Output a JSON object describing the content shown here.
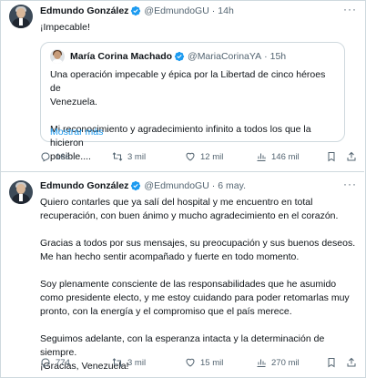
{
  "tweets": [
    {
      "author_name": "Edmundo González",
      "handle": "@EdmundoGU",
      "separator": "·",
      "time": "14h",
      "text": "¡Impecable!",
      "quote": {
        "author_name": "María Corina Machado",
        "handle": "@MariaCorinaYA",
        "separator": "·",
        "time": "15h",
        "text": "Una operación impecable y épica por la Libertad de cinco héroes de\nVenezuela.\n\nMi reconocimiento y agradecimiento infinito a todos los que la hicieron\nposible....",
        "show_more": "Mostrar más"
      },
      "replies": "166",
      "retweets": "3 mil",
      "likes": "12 mil",
      "views": "146 mil"
    },
    {
      "author_name": "Edmundo González",
      "handle": "@EdmundoGU",
      "separator": "·",
      "time": "6 may.",
      "text": "Quiero contarles que ya salí del hospital y me encuentro en total\nrecuperación, con buen ánimo y mucho agradecimiento en el corazón.\n\nGracias a todos por sus mensajes, su preocupación y sus buenos deseos.\nMe han hecho sentir acompañado y fuerte en todo momento.\n\nSoy plenamente consciente de las responsabilidades que he asumido\ncomo presidente electo, y me estoy cuidando para poder retomarlas muy\npronto, con la energía y el compromiso que el país merece.\n\nSeguimos adelante, con la esperanza intacta y la determinación de\nsiempre.\n¡Gracias, Venezuela!",
      "replies": "774",
      "retweets": "3 mil",
      "likes": "15 mil",
      "views": "270 mil"
    }
  ],
  "icons": {
    "verified": "verified-badge-icon",
    "more": "more-options-icon",
    "reply": "reply-icon",
    "retweet": "retweet-icon",
    "like": "like-icon",
    "views": "views-icon",
    "bookmark": "bookmark-icon",
    "share": "share-icon"
  },
  "colors": {
    "accent": "#1d9bf0",
    "text": "#0f1419",
    "muted": "#536471",
    "border": "#cfd9de"
  }
}
